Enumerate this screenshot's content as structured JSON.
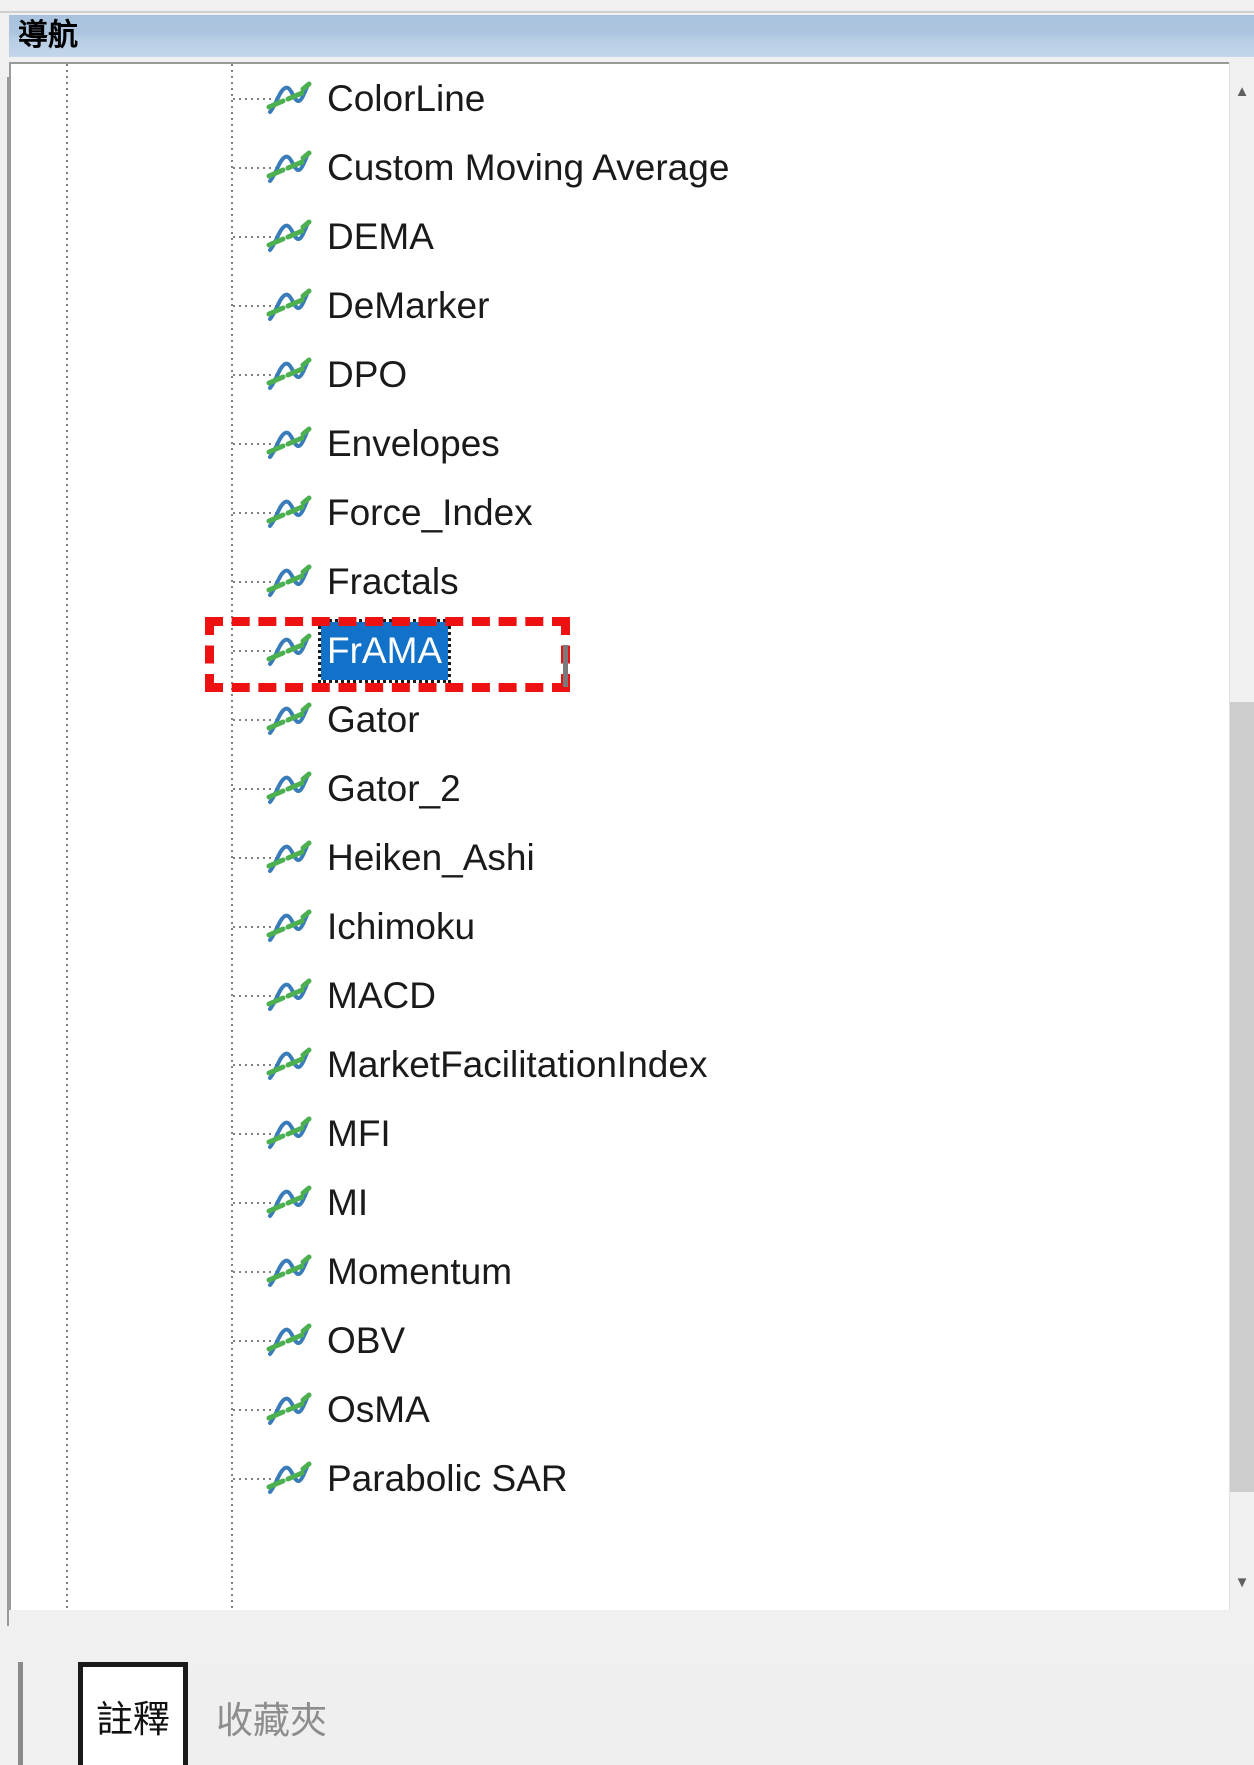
{
  "window": {
    "title": "導航"
  },
  "tree": {
    "icon_name": "indicator-wave-icon",
    "selected_item": "FrAMA",
    "items": [
      {
        "label": "ColorLine",
        "selected": false
      },
      {
        "label": "Custom Moving Average",
        "selected": false
      },
      {
        "label": "DEMA",
        "selected": false
      },
      {
        "label": "DeMarker",
        "selected": false
      },
      {
        "label": "DPO",
        "selected": false
      },
      {
        "label": "Envelopes",
        "selected": false
      },
      {
        "label": "Force_Index",
        "selected": false
      },
      {
        "label": "Fractals",
        "selected": false
      },
      {
        "label": "FrAMA",
        "selected": true
      },
      {
        "label": "Gator",
        "selected": false
      },
      {
        "label": "Gator_2",
        "selected": false
      },
      {
        "label": "Heiken_Ashi",
        "selected": false
      },
      {
        "label": "Ichimoku",
        "selected": false
      },
      {
        "label": "MACD",
        "selected": false
      },
      {
        "label": "MarketFacilitationIndex",
        "selected": false
      },
      {
        "label": "MFI",
        "selected": false
      },
      {
        "label": "MI",
        "selected": false
      },
      {
        "label": "Momentum",
        "selected": false
      },
      {
        "label": "OBV",
        "selected": false
      },
      {
        "label": "OsMA",
        "selected": false
      },
      {
        "label": "Parabolic SAR",
        "selected": false
      }
    ]
  },
  "scrollbar": {
    "up_arrow": "▲",
    "down_arrow": "▼"
  },
  "tabs": [
    {
      "label": "註釋",
      "active": true
    },
    {
      "label": "收藏夾",
      "active": false
    }
  ],
  "annotation": {
    "color": "#ee1111",
    "target": "FrAMA"
  },
  "colors": {
    "titlebar": "#b0c7e0",
    "selection": "#1271c8",
    "icon_blue": "#3a7cb8",
    "icon_green": "#4caf50",
    "annotation_red": "#ee1111"
  }
}
